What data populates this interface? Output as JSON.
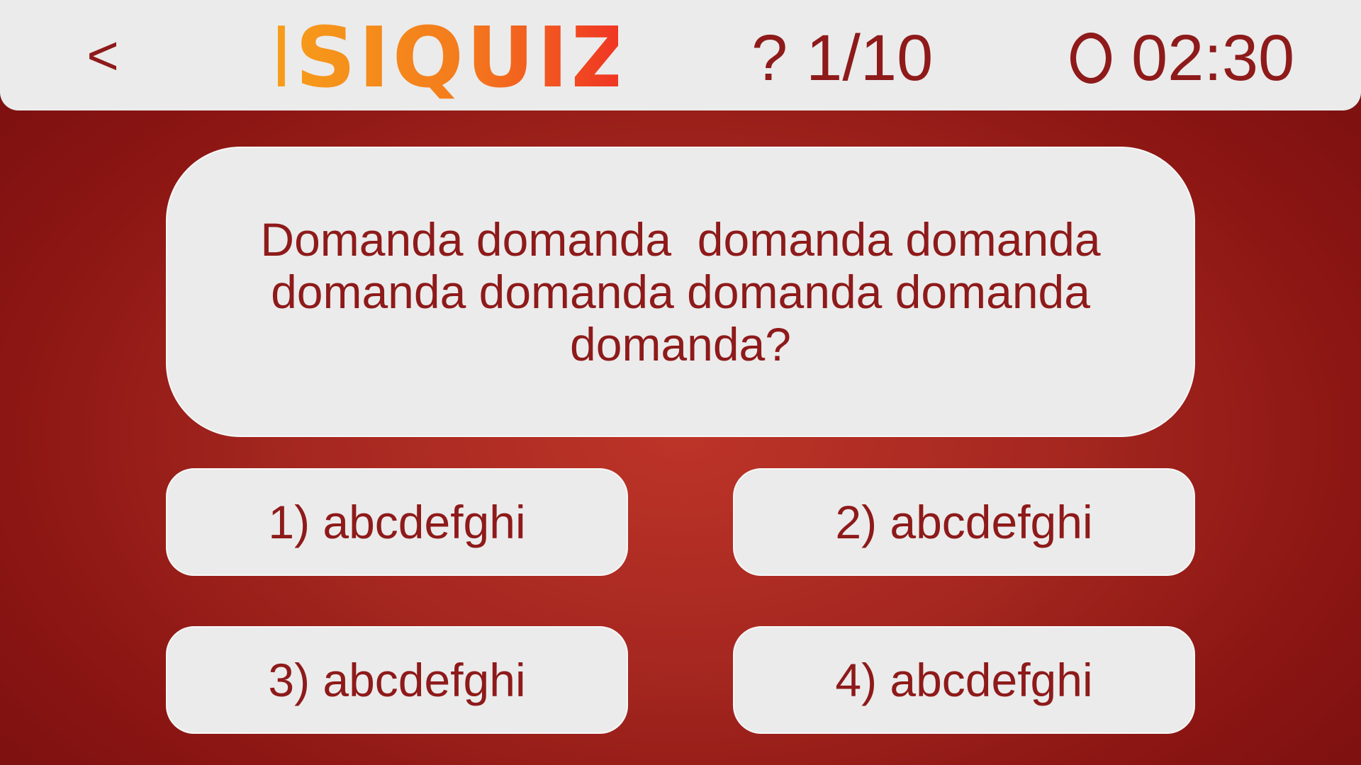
{
  "header": {
    "back_label": "<",
    "logo_text": "ISIQUIZ",
    "question_icon": "?",
    "question_counter": "1/10",
    "timer_icon": "clock-icon",
    "timer_value": "02:30"
  },
  "question": {
    "text": "Domanda domanda  domanda domanda domanda domanda domanda domanda domanda?"
  },
  "answers": [
    {
      "label": "1) abcdefghi"
    },
    {
      "label": "2) abcdefghi"
    },
    {
      "label": "3) abcdefghi"
    },
    {
      "label": "4) abcdefghi"
    }
  ],
  "colors": {
    "text_dark_red": "#8e1a1a",
    "panel_light_gray": "#ebebeb",
    "background_red": "#a52720",
    "logo_orange": "#f28c1f",
    "logo_red": "#ef3b24"
  }
}
